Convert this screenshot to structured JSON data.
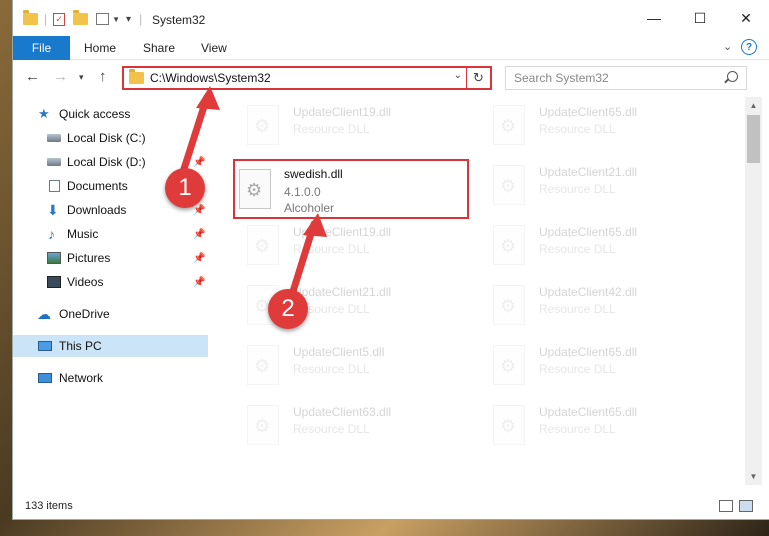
{
  "window": {
    "title": "System32",
    "controls": {
      "minimize": "—",
      "maximize": "☐",
      "close": "✕"
    }
  },
  "ribbon": {
    "file": "File",
    "tabs": [
      "Home",
      "Share",
      "View"
    ]
  },
  "address_bar": {
    "path": "C:\\Windows\\System32",
    "search_placeholder": "Search System32"
  },
  "sidebar": {
    "items": [
      {
        "label": "Quick access",
        "icon": "star-icon",
        "pinned": false
      },
      {
        "label": "Local Disk (C:)",
        "icon": "disk-icon",
        "pinned": false
      },
      {
        "label": "Local Disk (D:)",
        "icon": "disk-icon",
        "pinned": true
      },
      {
        "label": "Documents",
        "icon": "documents-icon",
        "pinned": false
      },
      {
        "label": "Downloads",
        "icon": "downloads-icon",
        "pinned": true
      },
      {
        "label": "Music",
        "icon": "music-icon",
        "pinned": true
      },
      {
        "label": "Pictures",
        "icon": "pictures-icon",
        "pinned": true
      },
      {
        "label": "Videos",
        "icon": "videos-icon",
        "pinned": true
      },
      {
        "label": "OneDrive",
        "icon": "onedrive-icon",
        "pinned": false
      },
      {
        "label": "This PC",
        "icon": "this-pc-icon",
        "pinned": false,
        "selected": true
      },
      {
        "label": "Network",
        "icon": "network-icon",
        "pinned": false
      }
    ]
  },
  "files": [
    {
      "name": "UpdateClient19.dll",
      "line2": "Resource DLL",
      "line3": "",
      "faded": true
    },
    {
      "name": "UpdateClient65.dll",
      "line2": "Resource DLL",
      "line3": "",
      "faded": true
    },
    {
      "name": "swedish.dll",
      "line2": "4.1.0.0",
      "line3": "Alcoholer",
      "faded": false,
      "highlighted": true
    },
    {
      "name": "UpdateClient21.dll",
      "line2": "Resource DLL",
      "line3": "",
      "faded": true
    },
    {
      "name": "UpdateClient19.dll",
      "line2": "Resource DLL",
      "line3": "",
      "faded": true
    },
    {
      "name": "UpdateClient65.dll",
      "line2": "Resource DLL",
      "line3": "",
      "faded": true
    },
    {
      "name": "UpdateClient21.dll",
      "line2": "Resource DLL",
      "line3": "",
      "faded": true
    },
    {
      "name": "UpdateClient42.dll",
      "line2": "Resource DLL",
      "line3": "",
      "faded": true
    },
    {
      "name": "UpdateClient5.dll",
      "line2": "Resource DLL",
      "line3": "",
      "faded": true
    },
    {
      "name": "UpdateClient65.dll",
      "line2": "Resource DLL",
      "line3": "",
      "faded": true
    },
    {
      "name": "UpdateClient63.dll",
      "line2": "Resource DLL",
      "line3": "",
      "faded": true
    },
    {
      "name": "UpdateClient65.dll",
      "line2": "Resource DLL",
      "line3": "",
      "faded": true
    }
  ],
  "status": {
    "item_count": "133 items"
  },
  "annotations": {
    "step1": "1",
    "step2": "2",
    "color": "#e03b3b"
  }
}
